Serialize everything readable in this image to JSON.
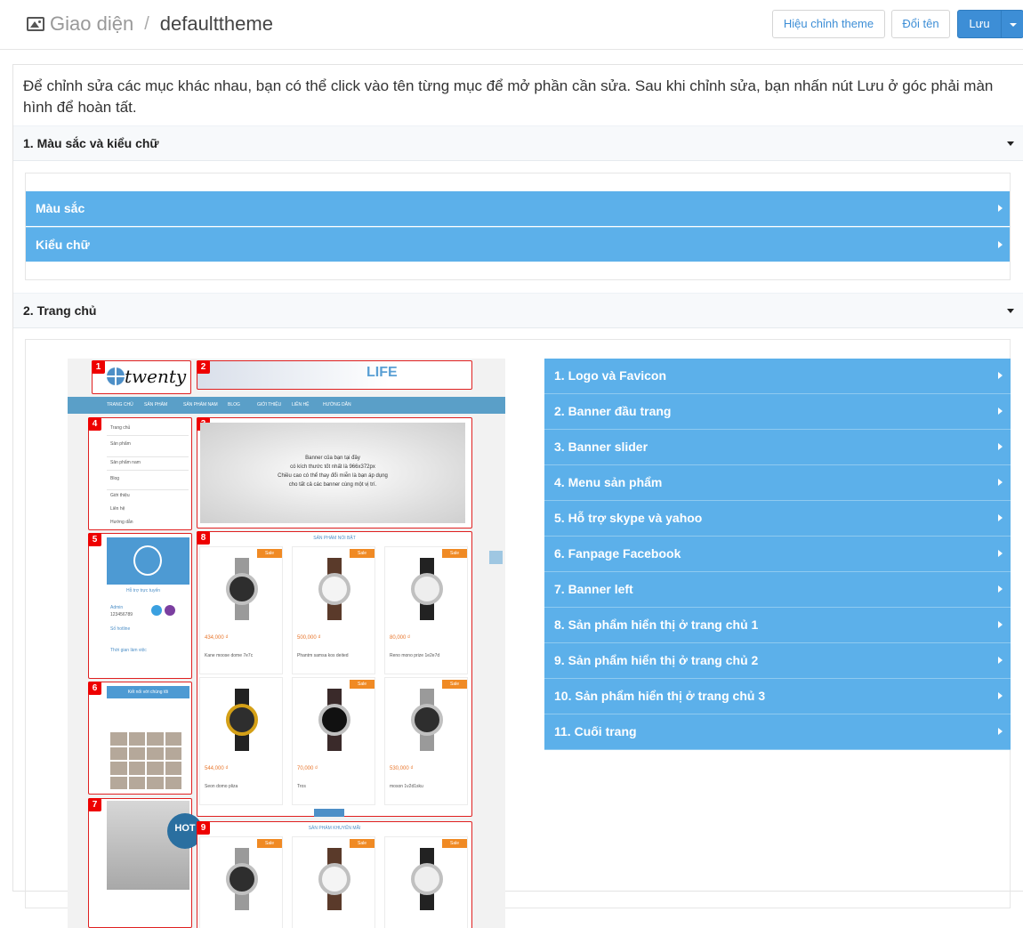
{
  "header": {
    "breadcrumb_root": "Giao diện",
    "breadcrumb_separator": "/",
    "breadcrumb_current": "defaulttheme",
    "buttons": {
      "edit_theme": "Hiệu chỉnh theme",
      "rename": "Đổi tên",
      "save": "Lưu"
    }
  },
  "intro": "Để chỉnh sửa các mục khác nhau, bạn có thể click vào tên từng mục để mở phần cần sửa. Sau khi chỉnh sửa, bạn nhấn nút Lưu ở góc phải màn hình để hoàn tất.",
  "section1": {
    "title": "1. Màu sắc và kiểu chữ",
    "items": [
      "Màu sắc",
      "Kiểu chữ"
    ]
  },
  "section2": {
    "title": "2. Trang chủ",
    "items": [
      "1. Logo và Favicon",
      "2. Banner đầu trang",
      "3. Banner slider",
      "4. Menu sản phẩm",
      "5. Hỗ trợ skype và yahoo",
      "6. Fanpage Facebook",
      "7. Banner left",
      "8. Sản phẩm hiển thị ở trang chủ 1",
      "9. Sản phẩm hiển thị ở trang chủ 2",
      "10. Sản phẩm hiển thị ở trang chủ 3",
      "11. Cuối trang"
    ]
  },
  "preview": {
    "zone_numbers": [
      "1",
      "2",
      "3",
      "4",
      "5",
      "6",
      "7",
      "8",
      "9"
    ],
    "logo_text": "twenty",
    "banner_text": "LIFE",
    "nav_items": [
      "TRANG CHỦ",
      "SẢN PHẨM",
      "SẢN PHẨM NAM",
      "BLOG",
      "GIỚI THIỆU",
      "LIÊN HỆ",
      "HƯỚNG DẪN"
    ],
    "menu_items": [
      "Trang chủ",
      "Sản phẩm",
      "Sản phẩm nam",
      "Blog",
      "Giới thiệu",
      "Liên hệ",
      "Hướng dẫn"
    ],
    "slider_lines": [
      "Banner của bạn tại đây",
      "có kích thước tốt nhất là 966x372px",
      "Chiều cao có thể thay đổi miễn là bạn áp dụng",
      "cho tất cả các banner cùng một vị trí."
    ],
    "support_title": "Hỗ trợ trực tuyến",
    "support_admin": "Admin",
    "support_phone": "123456789",
    "support_hotline": "Số hotline",
    "support_time": "Thời gian làm việc",
    "fb_title": "Kết nối với chúng tôi",
    "hot_text": "HOT",
    "featured_title": "SẢN PHẨM NỔI BẬT",
    "sale_title": "SẢN PHẨM KHUYẾN MÃI",
    "sale_label": "Sale",
    "prices": [
      "434,000 ₫",
      "500,000 ₫",
      "80,000 ₫",
      "544,000 ₫",
      "70,000 ₫",
      "530,000 ₫"
    ],
    "names": [
      "Kane moose dome 7e7c",
      "Phantm samsa kos deited",
      "Reno mono prize 1e2e7d",
      "Seon domo pliza",
      "Tros",
      "moson 1v2d1sku"
    ]
  },
  "colors": {
    "accent": "#5cb0ea",
    "primary_button": "#3d8ed6",
    "zone_border": "#e02020",
    "sale": "#f08a24"
  }
}
